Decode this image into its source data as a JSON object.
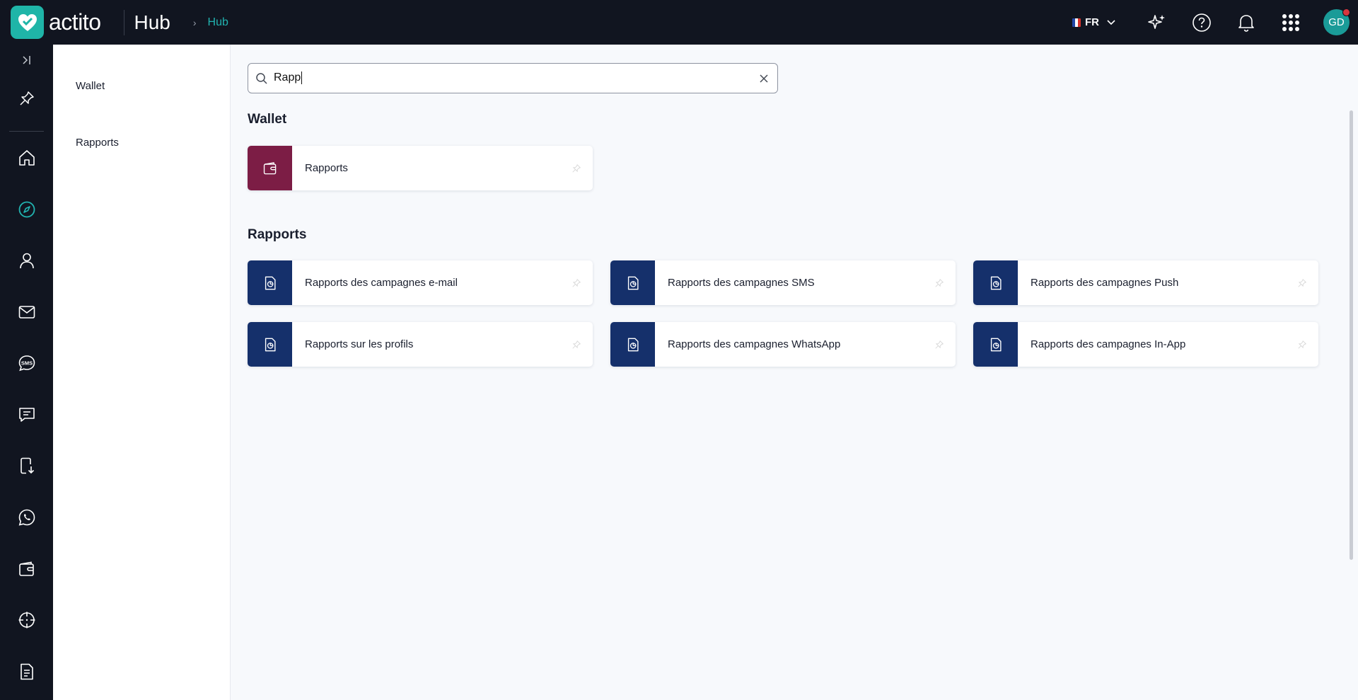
{
  "header": {
    "logo_text": "actito",
    "app_title": "Hub",
    "breadcrumb": "Hub",
    "language": "FR",
    "avatar_initials": "GD"
  },
  "colors": {
    "topbar": "#111520",
    "accent": "#21b3b0",
    "wallet_tile": "#7c1d45",
    "report_tile": "#15306b"
  },
  "rail": {
    "items": [
      {
        "name": "expand-icon"
      },
      {
        "name": "pin-icon"
      },
      {
        "name": "home-icon"
      },
      {
        "name": "compass-icon"
      },
      {
        "name": "user-icon"
      },
      {
        "name": "mail-icon"
      },
      {
        "name": "sms-icon"
      },
      {
        "name": "chat-icon"
      },
      {
        "name": "mobile-download-icon"
      },
      {
        "name": "whatsapp-icon"
      },
      {
        "name": "wallet-icon"
      },
      {
        "name": "target-icon"
      },
      {
        "name": "document-icon"
      }
    ]
  },
  "subnav": {
    "items": [
      "Wallet",
      "Rapports"
    ]
  },
  "search": {
    "value": "Rapp"
  },
  "sections": [
    {
      "title": "Wallet",
      "cards": [
        "Rapports"
      ]
    },
    {
      "title": "Rapports",
      "cards": [
        "Rapports des campagnes e-mail",
        "Rapports des campagnes SMS",
        "Rapports des campagnes Push",
        "Rapports sur les profils",
        "Rapports des campagnes WhatsApp",
        "Rapports des campagnes In-App"
      ]
    }
  ]
}
